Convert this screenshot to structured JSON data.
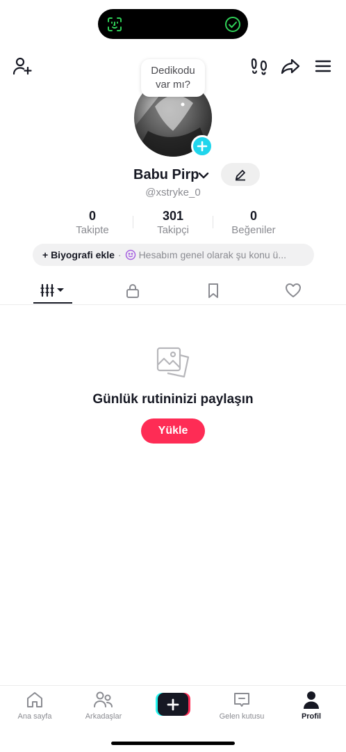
{
  "profile": {
    "bubble_line1": "Dedikodu",
    "bubble_line2": "var mı?",
    "display_name": "Babu Pirp",
    "username": "@xstryke_0"
  },
  "stats": [
    {
      "value": "0",
      "label": "Takipte"
    },
    {
      "value": "301",
      "label": "Takipçi"
    },
    {
      "value": "0",
      "label": "Beğeniler"
    }
  ],
  "bio": {
    "add_label": "+ Biyografi ekle",
    "separator": "·",
    "hint": "Hesabım genel olarak şu konu ü..."
  },
  "empty_state": {
    "title": "Günlük rutininizi paylaşın",
    "upload_label": "Yükle"
  },
  "nav": [
    {
      "label": "Ana sayfa",
      "icon": "home-icon"
    },
    {
      "label": "Arkadaşlar",
      "icon": "friends-icon"
    },
    {
      "label": "",
      "icon": "create-icon"
    },
    {
      "label": "Gelen kutusu",
      "icon": "inbox-icon"
    },
    {
      "label": "Profil",
      "icon": "profile-icon"
    }
  ],
  "colors": {
    "accent": "#fe2c55",
    "cyan": "#25f4ee",
    "avatar_add": "#20d5ec",
    "text": "#161823",
    "muted": "#8a8b91",
    "faceid_green": "#30d158"
  }
}
